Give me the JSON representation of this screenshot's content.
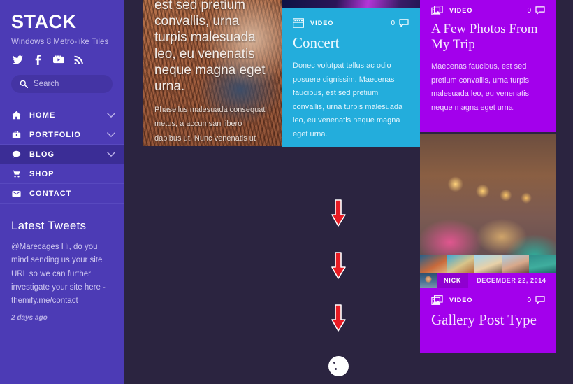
{
  "sidebar": {
    "brand": "STACK",
    "tagline": "Windows 8 Metro-like Tiles",
    "social": [
      {
        "name": "twitter-icon",
        "label": "Twitter"
      },
      {
        "name": "facebook-icon",
        "label": "Facebook"
      },
      {
        "name": "youtube-icon",
        "label": "YouTube"
      },
      {
        "name": "rss-icon",
        "label": "RSS"
      }
    ],
    "search": {
      "placeholder": "Search",
      "value": ""
    },
    "nav": [
      {
        "label": "HOME",
        "icon": "home-icon",
        "has_chevron": true,
        "active": false
      },
      {
        "label": "PORTFOLIO",
        "icon": "briefcase-icon",
        "has_chevron": true,
        "active": false
      },
      {
        "label": "BLOG",
        "icon": "comment-icon",
        "has_chevron": true,
        "active": true
      },
      {
        "label": "SHOP",
        "icon": "cart-icon",
        "has_chevron": false,
        "active": false
      },
      {
        "label": "CONTACT",
        "icon": "envelope-icon",
        "has_chevron": false,
        "active": false
      }
    ],
    "tweets": {
      "title": "Latest Tweets",
      "body": "@Marecages Hi, do you mind sending us your site URL so we can further investigate your site here - themify.me/contact",
      "time": "2 days ago"
    }
  },
  "tiles": {
    "photo_field": {
      "heading": "est sed pretium convallis, urna turpis malesuada leo, eu venenatis neque magna eget urna.",
      "body": "Phasellus malesuada consequat metus, a accumsan libero dapibus ut. Nunc venenatis ut libero vitae porta."
    },
    "concert": {
      "meta_label": "VIDEO",
      "meta_icon": "film-strip-icon",
      "comment_count": "0",
      "comment_icon": "comment-bubble-icon",
      "title": "Concert",
      "text": "Donec volutpat tellus ac odio posuere dignissim. Maecenas faucibus, est sed pretium convallis, urna turpis malesuada leo, eu venenatis neque magna eget urna."
    },
    "photos_trip": {
      "meta_label": "VIDEO",
      "meta_icon": "gallery-icon",
      "comment_count": "0",
      "comment_icon": "comment-bubble-icon",
      "title": "A Few Photos From My Trip",
      "text": "Maecenas faucibus, est sed pretium convallis, urna turpis malesuada leo, eu venenatis neque magna eget urna."
    },
    "gallery_post": {
      "author": "NICK",
      "date": "DECEMBER 22, 2014",
      "meta_label": "VIDEO",
      "meta_icon": "gallery-icon",
      "comment_count": "0",
      "comment_icon": "comment-bubble-icon",
      "title": "Gallery Post Type"
    },
    "cafe_thumbs": [
      {
        "name": "thumbnail-1"
      },
      {
        "name": "thumbnail-2"
      },
      {
        "name": "thumbnail-3"
      },
      {
        "name": "thumbnail-4"
      },
      {
        "name": "thumbnail-5"
      }
    ]
  },
  "annotations": {
    "arrows": [
      {
        "name": "down-arrow-1",
        "direction": "down"
      },
      {
        "name": "down-arrow-2",
        "direction": "down"
      },
      {
        "name": "down-arrow-3",
        "direction": "down"
      }
    ],
    "circle_marker": {
      "name": "scroll-marker"
    }
  },
  "colors": {
    "sidebar": "#4c3bb5",
    "sidebar_active": "#3b2d96",
    "background": "#2b2440",
    "cyan_tile": "#23addc",
    "violet_tile": "#a300ec",
    "arrow_red": "#e81b23"
  }
}
